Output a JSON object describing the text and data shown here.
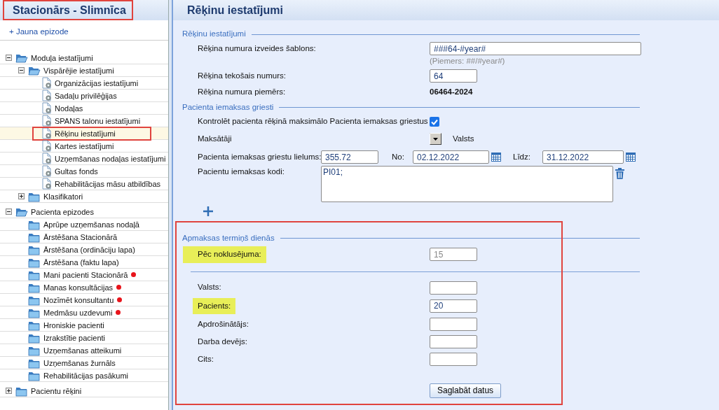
{
  "sidebar": {
    "title": "Stacionārs - Slimnīca",
    "title_annotated": true,
    "new_link": "+ Jauna epizode",
    "tree": [
      {
        "label": "Moduļa iestatījumi",
        "kind": "folder",
        "expanded": true,
        "selected": false,
        "children": [
          {
            "label": "Vispārējie iestatījumi",
            "kind": "folder",
            "expanded": true,
            "selected": false,
            "children": [
              {
                "label": "Organizācijas iestatījumi",
                "kind": "page",
                "selected": false
              },
              {
                "label": "Sadaļu privilēģijas",
                "kind": "page",
                "selected": false
              },
              {
                "label": "Nodaļas",
                "kind": "page",
                "selected": false
              },
              {
                "label": "SPANS talonu iestatījumi",
                "kind": "page",
                "selected": false
              },
              {
                "label": "Rēķinu iestatījumi",
                "kind": "page",
                "selected": true,
                "annotated": true
              },
              {
                "label": "Kartes iestatījumi",
                "kind": "page",
                "selected": false
              },
              {
                "label": "Uzņemšanas nodaļas iestatījumi",
                "kind": "page",
                "selected": false
              },
              {
                "label": "Gultas fonds",
                "kind": "page",
                "selected": false
              },
              {
                "label": "Rehabilitācijas māsu atbildības",
                "kind": "page",
                "selected": false
              }
            ]
          },
          {
            "label": "Klasifikatori",
            "kind": "folder",
            "expanded": false,
            "selected": false
          }
        ]
      },
      {
        "label": "Pacienta epizodes",
        "kind": "folder",
        "expanded": true,
        "selected": false,
        "children": [
          {
            "label": "Aprūpe uzņemšanas nodaļā",
            "kind": "section",
            "selected": false,
            "alert": false
          },
          {
            "label": "Ārstēšana Stacionārā",
            "kind": "section",
            "selected": false,
            "alert": false
          },
          {
            "label": "Ārstēšana (ordināciju lapa)",
            "kind": "section",
            "selected": false,
            "alert": false
          },
          {
            "label": "Ārstēšana (faktu lapa)",
            "kind": "section",
            "selected": false,
            "alert": false
          },
          {
            "label": "Mani pacienti Stacionārā",
            "kind": "section",
            "selected": false,
            "alert": true
          },
          {
            "label": "Manas konsultācijas",
            "kind": "section",
            "selected": false,
            "alert": true
          },
          {
            "label": "Nozīmēt konsultantu",
            "kind": "section",
            "selected": false,
            "alert": true
          },
          {
            "label": "Medmāsu uzdevumi",
            "kind": "section",
            "selected": false,
            "alert": true
          },
          {
            "label": "Hroniskie pacienti",
            "kind": "section",
            "selected": false,
            "alert": false
          },
          {
            "label": "Izrakstītie pacienti",
            "kind": "section",
            "selected": false,
            "alert": false
          },
          {
            "label": "Uzņemšanas atteikumi",
            "kind": "section",
            "selected": false,
            "alert": false
          },
          {
            "label": "Uzņemšanas žurnāls",
            "kind": "section",
            "selected": false,
            "alert": false
          },
          {
            "label": "Rehabilitācijas pasākumi",
            "kind": "section",
            "selected": false,
            "alert": false
          }
        ]
      },
      {
        "label": "Pacientu rēķini",
        "kind": "folder",
        "expanded": false,
        "selected": false
      }
    ]
  },
  "panel": {
    "title": "Rēķinu iestatījumi",
    "sections": [
      {
        "legend": "Rēķinu iestatījumi",
        "rows": [
          {
            "kind": "wide-input",
            "label": "Rēķina numura izveides šablons:",
            "value": "###64-#year#",
            "hint": "(Piemers: ##/#year#)"
          },
          {
            "kind": "input",
            "label": "Rēķina tekošais numurs:",
            "value": "64"
          },
          {
            "kind": "text",
            "label": "Rēķina numura piemērs:",
            "value": "06464-2024"
          }
        ]
      },
      {
        "legend": "Pacienta iemaksas griesti",
        "rows": [
          {
            "kind": "checkbox",
            "label": "Kontrolēt pacienta rēķinā maksimālo Pacienta iemaksas griestus",
            "checked": true
          },
          {
            "kind": "dropdown",
            "label": "Maksātāji",
            "value": "Valsts"
          },
          {
            "kind": "ceiling",
            "label": "Pacienta iemaksas griestu lielums:",
            "value": "355.72",
            "from_label": "No:",
            "from": "02.12.2022",
            "to_label": "Līdz:",
            "to": "31.12.2022"
          },
          {
            "kind": "textarea",
            "label": "Pacientu iemaksas kodi:",
            "value": "PI01;"
          },
          {
            "kind": "add"
          }
        ]
      },
      {
        "legend": "Apmaksas termiņš dienās",
        "annotated": true,
        "rows": [
          {
            "kind": "input",
            "label": "Pēc noklusējuma:",
            "placeholder": "15",
            "highlighted": true
          },
          {
            "kind": "separator"
          },
          {
            "kind": "input",
            "label": "Valsts:",
            "highlighted": false
          },
          {
            "kind": "input",
            "label": "Pacients:",
            "value": "20",
            "highlighted": true
          },
          {
            "kind": "input",
            "label": "Apdrošinātājs:",
            "highlighted": false
          },
          {
            "kind": "input",
            "label": "Darba devējs:",
            "highlighted": false
          },
          {
            "kind": "input",
            "label": "Cits:",
            "highlighted": false
          },
          {
            "kind": "button",
            "label": "Saglabāt datus"
          }
        ]
      }
    ]
  }
}
